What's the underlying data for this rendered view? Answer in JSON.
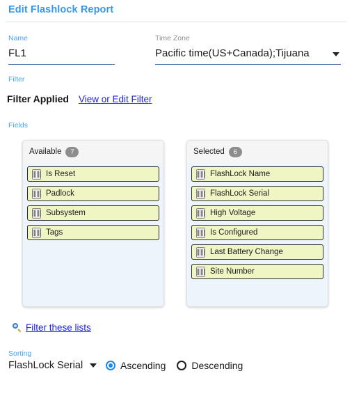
{
  "header": {
    "title": "Edit Flashlock Report"
  },
  "form": {
    "name": {
      "label": "Name",
      "value": "FL1",
      "placeholder": ""
    },
    "time_zone": {
      "label": "Time Zone",
      "value": "Pacific time(US+Canada);Tijuana",
      "caret_icon": "chevron-down-icon"
    }
  },
  "filter": {
    "section_label": "Filter",
    "status_text": "Filter Applied",
    "link_text": "View or Edit Filter"
  },
  "fields": {
    "section_label": "Fields",
    "available": {
      "title": "Available",
      "count": "7",
      "items": [
        {
          "label": "Is Reset",
          "icon": "column-icon"
        },
        {
          "label": "Padlock",
          "icon": "column-icon"
        },
        {
          "label": "Subsystem",
          "icon": "column-icon"
        },
        {
          "label": "Tags",
          "icon": "column-icon"
        }
      ]
    },
    "selected": {
      "title": "Selected",
      "count": "6",
      "items": [
        {
          "label": "FlashLock Name",
          "icon": "column-icon"
        },
        {
          "label": "FlashLock Serial",
          "icon": "column-icon"
        },
        {
          "label": "High Voltage",
          "icon": "column-icon"
        },
        {
          "label": "Is Configured",
          "icon": "column-icon"
        },
        {
          "label": "Last Battery Change",
          "icon": "column-icon"
        },
        {
          "label": "Site Number",
          "icon": "column-icon"
        }
      ]
    }
  },
  "filter_lists": {
    "icon": "magnifier-icon",
    "link_text": "Filter these lists"
  },
  "sorting": {
    "section_label": "Sorting",
    "selected_field": "FlashLock Serial",
    "caret_icon": "chevron-down-icon",
    "direction": "Ascending",
    "options": [
      {
        "label": "Ascending",
        "checked": true
      },
      {
        "label": "Descending",
        "checked": false
      }
    ]
  },
  "colors": {
    "accent_blue": "#3399f0",
    "link_blue": "#2020ee",
    "chip_yellow": "#f0f5c4",
    "panel_body_blue": "#edf4fb",
    "badge_grey": "#8d8d8d",
    "radio_blue": "#1e88e5"
  }
}
